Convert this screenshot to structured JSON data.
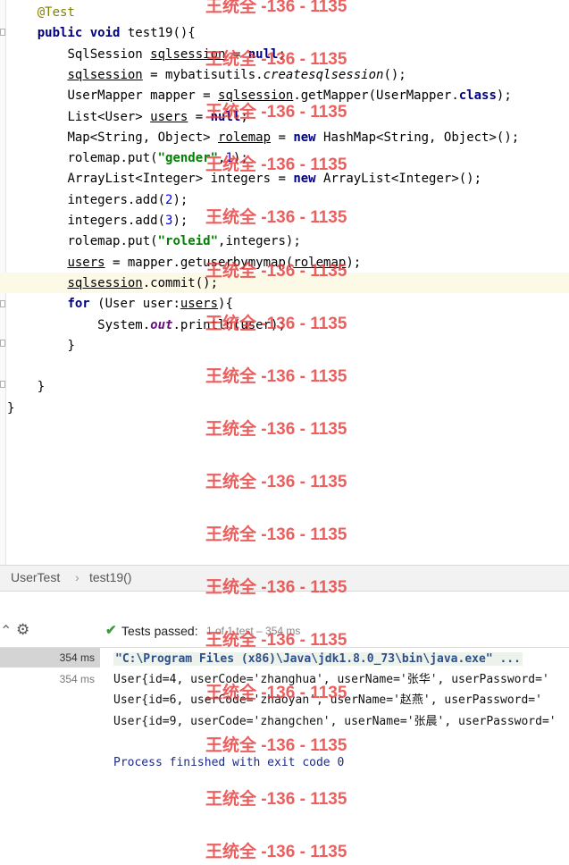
{
  "editor": {
    "lines": [
      {
        "parts": [
          {
            "c": "ann",
            "t": "@Test"
          }
        ],
        "indent": "    "
      },
      {
        "parts": [
          {
            "c": "kw",
            "t": "public void "
          },
          {
            "c": "",
            "t": "test19(){"
          }
        ],
        "indent": "    "
      },
      {
        "parts": [
          {
            "c": "",
            "t": "SqlSession "
          },
          {
            "c": "ul",
            "t": "sqlsession"
          },
          {
            "c": "",
            "t": " = "
          },
          {
            "c": "kw",
            "t": "null"
          },
          {
            "c": "",
            "t": ";"
          }
        ],
        "indent": "        "
      },
      {
        "parts": [
          {
            "c": "ul",
            "t": "sqlsession"
          },
          {
            "c": "",
            "t": " = mybatisutils."
          },
          {
            "c": "it",
            "t": "createsqlsession"
          },
          {
            "c": "",
            "t": "();"
          }
        ],
        "indent": "        "
      },
      {
        "parts": [
          {
            "c": "",
            "t": "UserMapper mapper = "
          },
          {
            "c": "ul",
            "t": "sqlsession"
          },
          {
            "c": "",
            "t": ".getMapper(UserMapper."
          },
          {
            "c": "kw",
            "t": "class"
          },
          {
            "c": "",
            "t": ");"
          }
        ],
        "indent": "        "
      },
      {
        "parts": [
          {
            "c": "",
            "t": "List<User> "
          },
          {
            "c": "ul",
            "t": "users"
          },
          {
            "c": "",
            "t": " = "
          },
          {
            "c": "kw",
            "t": "null"
          },
          {
            "c": "",
            "t": ";"
          }
        ],
        "indent": "        "
      },
      {
        "parts": [
          {
            "c": "",
            "t": "Map<String, Object> "
          },
          {
            "c": "ul",
            "t": "rolemap"
          },
          {
            "c": "",
            "t": " = "
          },
          {
            "c": "kw",
            "t": "new "
          },
          {
            "c": "",
            "t": "HashMap<String, Object>();"
          }
        ],
        "indent": "        "
      },
      {
        "parts": [
          {
            "c": "",
            "t": "rolemap.put("
          },
          {
            "c": "str",
            "t": "\"gender\""
          },
          {
            "c": "",
            "t": ","
          },
          {
            "c": "num",
            "t": "1"
          },
          {
            "c": "",
            "t": ");"
          }
        ],
        "indent": "        "
      },
      {
        "parts": [
          {
            "c": "",
            "t": "ArrayList<Integer> integers = "
          },
          {
            "c": "kw",
            "t": "new "
          },
          {
            "c": "",
            "t": "ArrayList<Integer>();"
          }
        ],
        "indent": "        "
      },
      {
        "parts": [
          {
            "c": "",
            "t": "integers.add("
          },
          {
            "c": "num",
            "t": "2"
          },
          {
            "c": "",
            "t": ");"
          }
        ],
        "indent": "        "
      },
      {
        "parts": [
          {
            "c": "",
            "t": "integers.add("
          },
          {
            "c": "num",
            "t": "3"
          },
          {
            "c": "",
            "t": ");"
          }
        ],
        "indent": "        "
      },
      {
        "parts": [
          {
            "c": "",
            "t": "rolemap.put("
          },
          {
            "c": "str",
            "t": "\"roleid\""
          },
          {
            "c": "",
            "t": ",integers);"
          }
        ],
        "indent": "        "
      },
      {
        "parts": [
          {
            "c": "ul",
            "t": "users"
          },
          {
            "c": "",
            "t": " = mapper.getuserbymymap("
          },
          {
            "c": "ul",
            "t": "rolemap"
          },
          {
            "c": "",
            "t": ");"
          }
        ],
        "indent": "        "
      },
      {
        "parts": [
          {
            "c": "ul",
            "t": "sqlsession"
          },
          {
            "c": "",
            "t": ".commit();"
          }
        ],
        "indent": "        "
      },
      {
        "parts": [
          {
            "c": "kw",
            "t": "for "
          },
          {
            "c": "",
            "t": "(User user:"
          },
          {
            "c": "ul",
            "t": "users"
          },
          {
            "c": "",
            "t": "){"
          }
        ],
        "indent": "        "
      },
      {
        "parts": [
          {
            "c": "",
            "t": "System."
          },
          {
            "c": "fld",
            "t": "out"
          },
          {
            "c": "",
            "t": ".println(user);"
          }
        ],
        "indent": "            "
      },
      {
        "parts": [
          {
            "c": "",
            "t": "}"
          }
        ],
        "indent": "        "
      },
      {
        "parts": [
          {
            "c": "",
            "t": ""
          }
        ],
        "indent": ""
      },
      {
        "parts": [
          {
            "c": "",
            "t": "}"
          }
        ],
        "indent": "    "
      },
      {
        "parts": [
          {
            "c": "",
            "t": "}"
          }
        ],
        "indent": ""
      }
    ]
  },
  "breadcrumb": {
    "class_name": "UserTest",
    "separator": "›",
    "method": "test19()"
  },
  "run_toolbar": {
    "status": "Tests passed:",
    "status_detail": "1 of 1 test – 354 ms"
  },
  "test_tree": [
    {
      "time": "354 ms",
      "selected": true
    },
    {
      "time": "354 ms",
      "selected": false
    }
  ],
  "console": {
    "lines": [
      {
        "cls": "cmd",
        "text": "\"C:\\Program Files (x86)\\Java\\jdk1.8.0_73\\bin\\java.exe\" ..."
      },
      {
        "cls": "out",
        "text": "User{id=4, userCode='zhanghua', userName='张华', userPassword='"
      },
      {
        "cls": "out",
        "text": "User{id=6, userCode='zhaoyan', userName='赵燕', userPassword='"
      },
      {
        "cls": "out",
        "text": "User{id=9, userCode='zhangchen', userName='张晨', userPassword='"
      },
      {
        "cls": "out",
        "text": ""
      },
      {
        "cls": "exit",
        "text": "Process finished with exit code 0"
      }
    ]
  },
  "watermark": {
    "text": "王统全 -136 - 1135",
    "count": 17
  },
  "colors": {
    "pass_check": "#3c9a3c",
    "highlight_line": "#fcfae6",
    "keyword": "#000080"
  }
}
